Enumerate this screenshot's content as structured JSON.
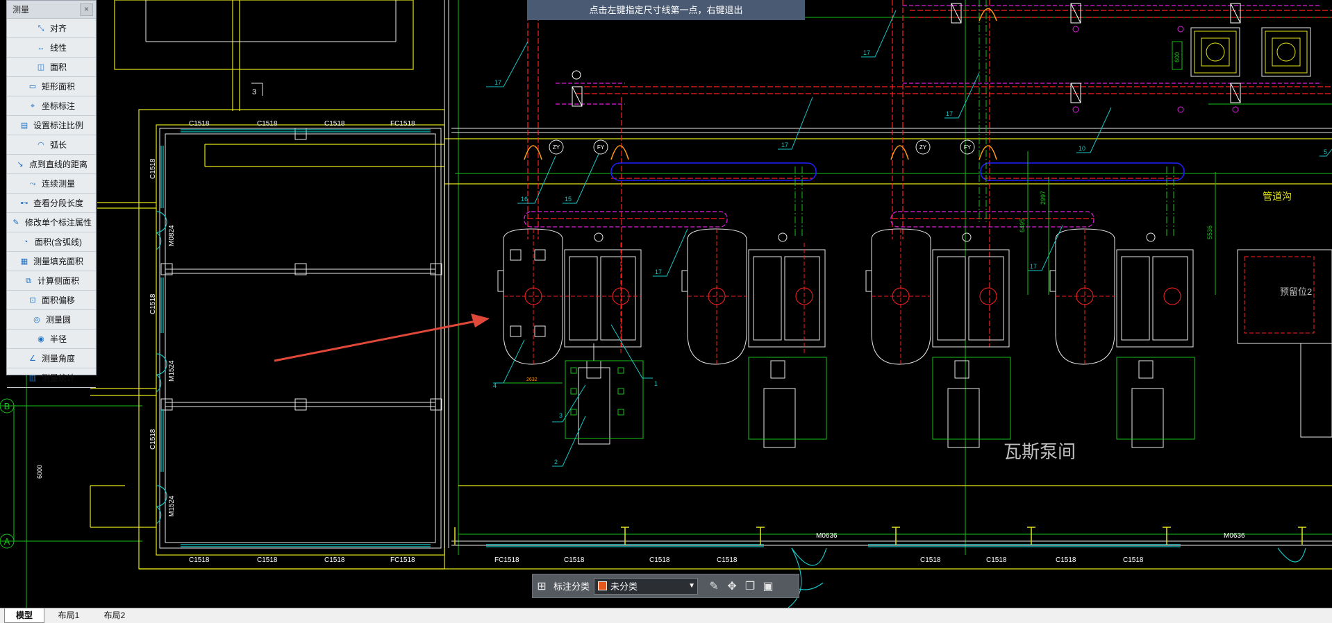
{
  "panel": {
    "title": "测量",
    "close": "×",
    "tools": [
      {
        "label": "对齐",
        "icon": "align-dim-icon"
      },
      {
        "label": "线性",
        "icon": "linear-dim-icon"
      },
      {
        "label": "面积",
        "icon": "area-icon"
      },
      {
        "label": "矩形面积",
        "icon": "rect-area-icon"
      },
      {
        "label": "坐标标注",
        "icon": "coordinate-icon"
      },
      {
        "label": "设置标注比例",
        "icon": "scale-icon"
      },
      {
        "label": "弧长",
        "icon": "arc-length-icon"
      },
      {
        "label": "点到直线的距离",
        "icon": "point-line-icon"
      },
      {
        "label": "连续测量",
        "icon": "continuous-measure-icon"
      },
      {
        "label": "查看分段长度",
        "icon": "segment-length-icon"
      },
      {
        "label": "修改单个标注属性",
        "icon": "edit-dim-icon"
      },
      {
        "label": "面积(含弧线)",
        "icon": "arc-area-icon"
      },
      {
        "label": "测量填充面积",
        "icon": "hatch-area-icon"
      },
      {
        "label": "计算侧面积",
        "icon": "side-area-icon"
      },
      {
        "label": "面积偏移",
        "icon": "area-offset-icon"
      },
      {
        "label": "测量圆",
        "icon": "circle-icon"
      },
      {
        "label": "半径",
        "icon": "radius-icon"
      },
      {
        "label": "测量角度",
        "icon": "angle-icon"
      },
      {
        "label": "测量统计",
        "icon": "stats-icon"
      }
    ]
  },
  "hint": "点击左键指定尺寸线第一点，右键退出",
  "toolbar": {
    "category_label": "标注分类",
    "category_value": "未分类",
    "category_color": "#e35a1c"
  },
  "tabs": [
    "模型",
    "布局1",
    "布局2"
  ],
  "cad": {
    "room_label": "瓦斯泵间",
    "trench_label": "管道沟",
    "reserved_label": "预留位2",
    "axis_b": "B",
    "axis_a": "A",
    "dim_6000": "6000",
    "window_c1518": "C1518",
    "window_fc1518": "FC1518",
    "door_m0636": "M0636",
    "door_m1524": "M1524",
    "door_m0824": "M0824",
    "tag_zy": "ZY",
    "tag_fy": "FY",
    "num_17": "17",
    "num_16": "16",
    "num_15": "15",
    "num_10": "10",
    "num_4": "4",
    "num_3": "3",
    "num_2": "2",
    "num_1": "1",
    "num_5": "5",
    "dim_2997": "2997",
    "dim_6495": "6495",
    "dim_5536": "5536",
    "dim_600": "600",
    "dim_2632": "2632"
  }
}
